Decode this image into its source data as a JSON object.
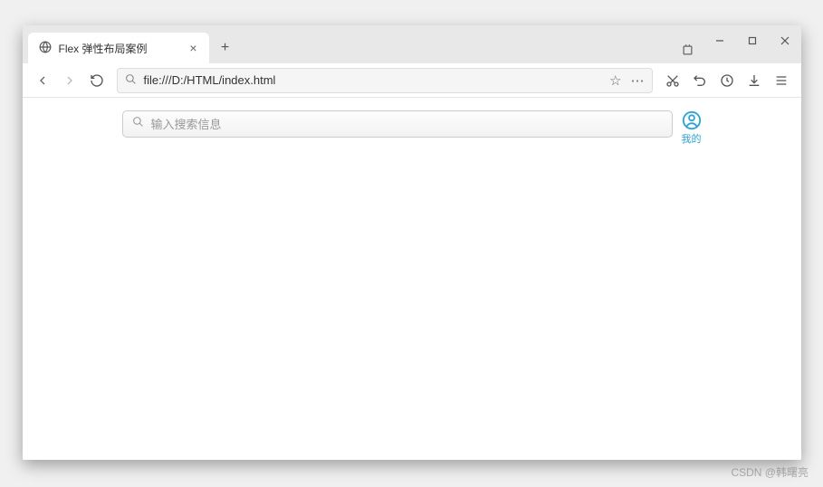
{
  "window": {
    "tab_title": "Flex 弹性布局案例",
    "url": "file:///D:/HTML/index.html"
  },
  "page": {
    "search_placeholder": "输入搜索信息",
    "profile_label": "我的"
  },
  "icons": {
    "globe": "globe-icon",
    "close": "×",
    "plus": "+",
    "extensions": "extensions-icon",
    "minimize": "minimize-icon",
    "maximize": "maximize-icon",
    "window_close": "close-icon",
    "back": "back-icon",
    "forward": "forward-icon",
    "reload": "reload-icon",
    "search": "search-icon",
    "star": "★",
    "dots": "⋯",
    "cut": "✂",
    "undo": "↺",
    "history": "⏲",
    "download": "⭳",
    "menu": "≡",
    "profile": "profile-icon"
  },
  "watermark": "CSDN @韩曙亮"
}
